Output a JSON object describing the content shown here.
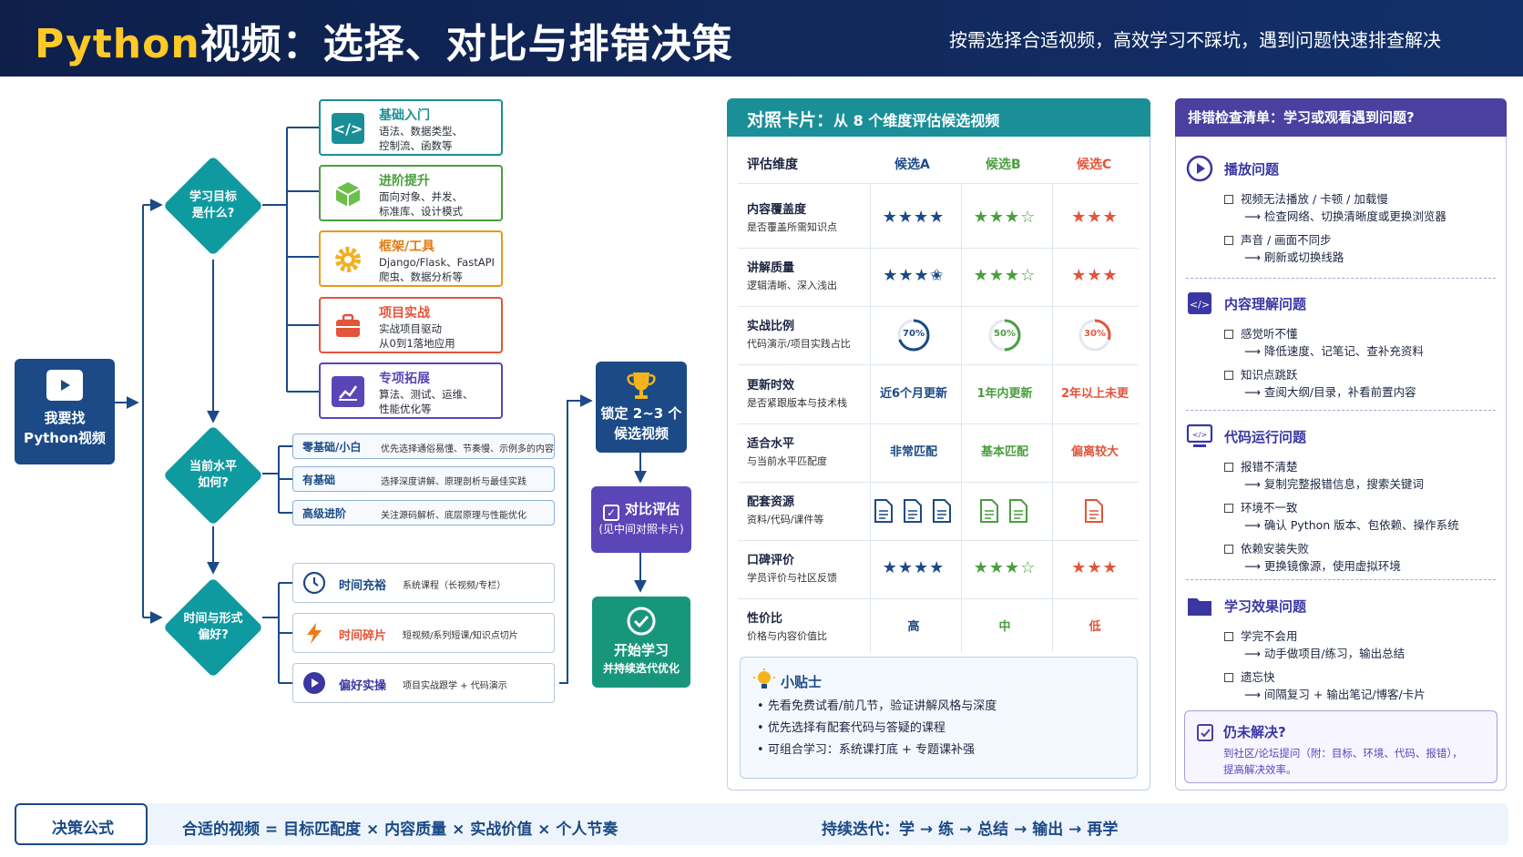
{
  "header": {
    "title_prefix": "Python",
    "title_rest": "视频：选择、对比与排错决策",
    "subtitle": "按需选择合适视频，高效学习不踩坑，遇到问题快速排查解决"
  },
  "flow": {
    "start": {
      "line1": "我要找",
      "line2": "Python视频"
    },
    "q1": {
      "line1": "学习目标",
      "line2": "是什么?"
    },
    "q2": {
      "line1": "当前水平",
      "line2": "如何?"
    },
    "q3": {
      "line1": "时间与形式",
      "line2": "偏好?"
    },
    "goals": [
      {
        "title": "基础入门",
        "desc1": "语法、数据类型、",
        "desc2": "控制流、函数等",
        "color": "#1a8f98",
        "icon": "code-icon"
      },
      {
        "title": "进阶提升",
        "desc1": "面向对象、并发、",
        "desc2": "标准库、设计模式",
        "color": "#4a9e3f",
        "icon": "cube-icon"
      },
      {
        "title": "框架/工具",
        "desc1": "Django/Flask、FastAPI",
        "desc2": "爬虫、数据分析等",
        "color": "#e99a1a",
        "icon": "gear-icon"
      },
      {
        "title": "项目实战",
        "desc1": "实战项目驱动",
        "desc2": "从0到1落地应用",
        "color": "#e2553a",
        "icon": "briefcase-icon"
      },
      {
        "title": "专项拓展",
        "desc1": "算法、测试、运维、",
        "desc2": "性能优化等",
        "color": "#5b46b8",
        "icon": "chart-icon"
      }
    ],
    "levels": [
      {
        "title": "零基础/小白",
        "desc": "优先选择通俗易懂、节奏慢、示例多的内容"
      },
      {
        "title": "有基础",
        "desc": "选择深度讲解、原理剖析与最佳实践"
      },
      {
        "title": "高级进阶",
        "desc": "关注源码解析、底层原理与性能优化"
      }
    ],
    "times": [
      {
        "title": "时间充裕",
        "desc": "系统课程（长视频/专栏）",
        "color": "#1b4a86",
        "icon": "clock-icon"
      },
      {
        "title": "时间碎片",
        "desc": "短视频/系列短课/知识点切片",
        "color": "#e2553a",
        "icon": "lightning-icon"
      },
      {
        "title": "偏好实操",
        "desc": "项目实战跟学 + 代码演示",
        "color": "#3a37a2",
        "icon": "play-icon"
      }
    ],
    "lock": {
      "line1": "锁定 2~3 个",
      "line2": "候选视频"
    },
    "compare": {
      "title": "对比评估",
      "sub": "(见中间对照卡片)"
    },
    "begin": {
      "line1": "开始学习",
      "line2": "并持续迭代优化"
    }
  },
  "comparison": {
    "title": "对照卡片：",
    "title_sub": "从 8 个维度评估候选视频",
    "dim_header": "评估维度",
    "candidates": [
      "候选A",
      "候选B",
      "候选C"
    ],
    "candidate_colors": [
      "#1b4a86",
      "#4a9e3f",
      "#e2553a"
    ],
    "rows": [
      {
        "title": "内容覆盖度",
        "desc": "是否覆盖所需知识点",
        "kind": "stars",
        "values": [
          "★★★★",
          "★★★☆",
          "★★★"
        ]
      },
      {
        "title": "讲解质量",
        "desc": "逻辑清晰、深入浅出",
        "kind": "stars",
        "values": [
          "★★★✬",
          "★★★☆",
          "★★★"
        ]
      },
      {
        "title": "实战比例",
        "desc": "代码演示/项目实践占比",
        "kind": "ring",
        "values": [
          "70%",
          "50%",
          "30%"
        ],
        "fractions": [
          0.7,
          0.5,
          0.3
        ]
      },
      {
        "title": "更新时效",
        "desc": "是否紧跟版本与技术栈",
        "kind": "text",
        "values": [
          "近6个月更新",
          "1年内更新",
          "2年以上未更"
        ]
      },
      {
        "title": "适合水平",
        "desc": "与当前水平匹配度",
        "kind": "text",
        "values": [
          "非常匹配",
          "基本匹配",
          "偏离较大"
        ]
      },
      {
        "title": "配套资源",
        "desc": "资料/代码/课件等",
        "kind": "docs",
        "counts": [
          3,
          2,
          1
        ]
      },
      {
        "title": "口碑评价",
        "desc": "学员评价与社区反馈",
        "kind": "stars",
        "values": [
          "★★★★",
          "★★★☆",
          "★★★"
        ]
      },
      {
        "title": "性价比",
        "desc": "价格与内容价值比",
        "kind": "text",
        "values": [
          "高",
          "中",
          "低"
        ]
      }
    ],
    "tips": {
      "title": "小贴士",
      "items": [
        "先看免费试看/前几节，验证讲解风格与深度",
        "优先选择有配套代码与答疑的课程",
        "可组合学习：系统课打底 + 专题课补强"
      ]
    }
  },
  "checklist": {
    "title": "排错检查清单：",
    "title_sub": "学习或观看遇到问题?",
    "sections": [
      {
        "title": "播放问题",
        "icon": "play-circle-icon",
        "items": [
          {
            "q": "视频无法播放 / 卡顿 / 加载慢",
            "a": "⟶  检查网络、切换清晰度或更换浏览器"
          },
          {
            "q": "声音 / 画面不同步",
            "a": "⟶  刷新或切换线路"
          }
        ]
      },
      {
        "title": "内容理解问题",
        "icon": "code-icon",
        "items": [
          {
            "q": "感觉听不懂",
            "a": "⟶  降低速度、记笔记、查补充资料"
          },
          {
            "q": "知识点跳跃",
            "a": "⟶  查阅大纲/目录，补看前置内容"
          }
        ]
      },
      {
        "title": "代码运行问题",
        "icon": "monitor-code-icon",
        "items": [
          {
            "q": "报错不清楚",
            "a": "⟶  复制完整报错信息，搜索关键词"
          },
          {
            "q": "环境不一致",
            "a": "⟶  确认 Python 版本、包依赖、操作系统"
          },
          {
            "q": "依赖安装失败",
            "a": "⟶  更换镜像源，使用虚拟环境"
          }
        ]
      },
      {
        "title": "学习效果问题",
        "icon": "folder-icon",
        "items": [
          {
            "q": "学完不会用",
            "a": "⟶  动手做项目/练习，输出总结"
          },
          {
            "q": "遗忘快",
            "a": "⟶  间隔复习 + 输出笔记/博客/卡片"
          }
        ]
      }
    ],
    "unresolved": {
      "title": "仍未解决?",
      "line1": "到社区/论坛提问（附：目标、环境、代码、报错），",
      "line2": "提高解决效率。"
    }
  },
  "footer": {
    "label": "决策公式",
    "formula": "合适的视频  =  目标匹配度  ×  内容质量  ×  实战价值  ×  个人节奏",
    "iteration": "持续迭代：学  →  练  →  总结  →  输出  →  再学"
  },
  "colors": {
    "navy": "#1b4a86",
    "teal": "#1a8f98",
    "purple": "#4b3fa0",
    "star_a": "#1b4a86",
    "star_b": "#4a9e3f",
    "star_c": "#e2553a"
  }
}
